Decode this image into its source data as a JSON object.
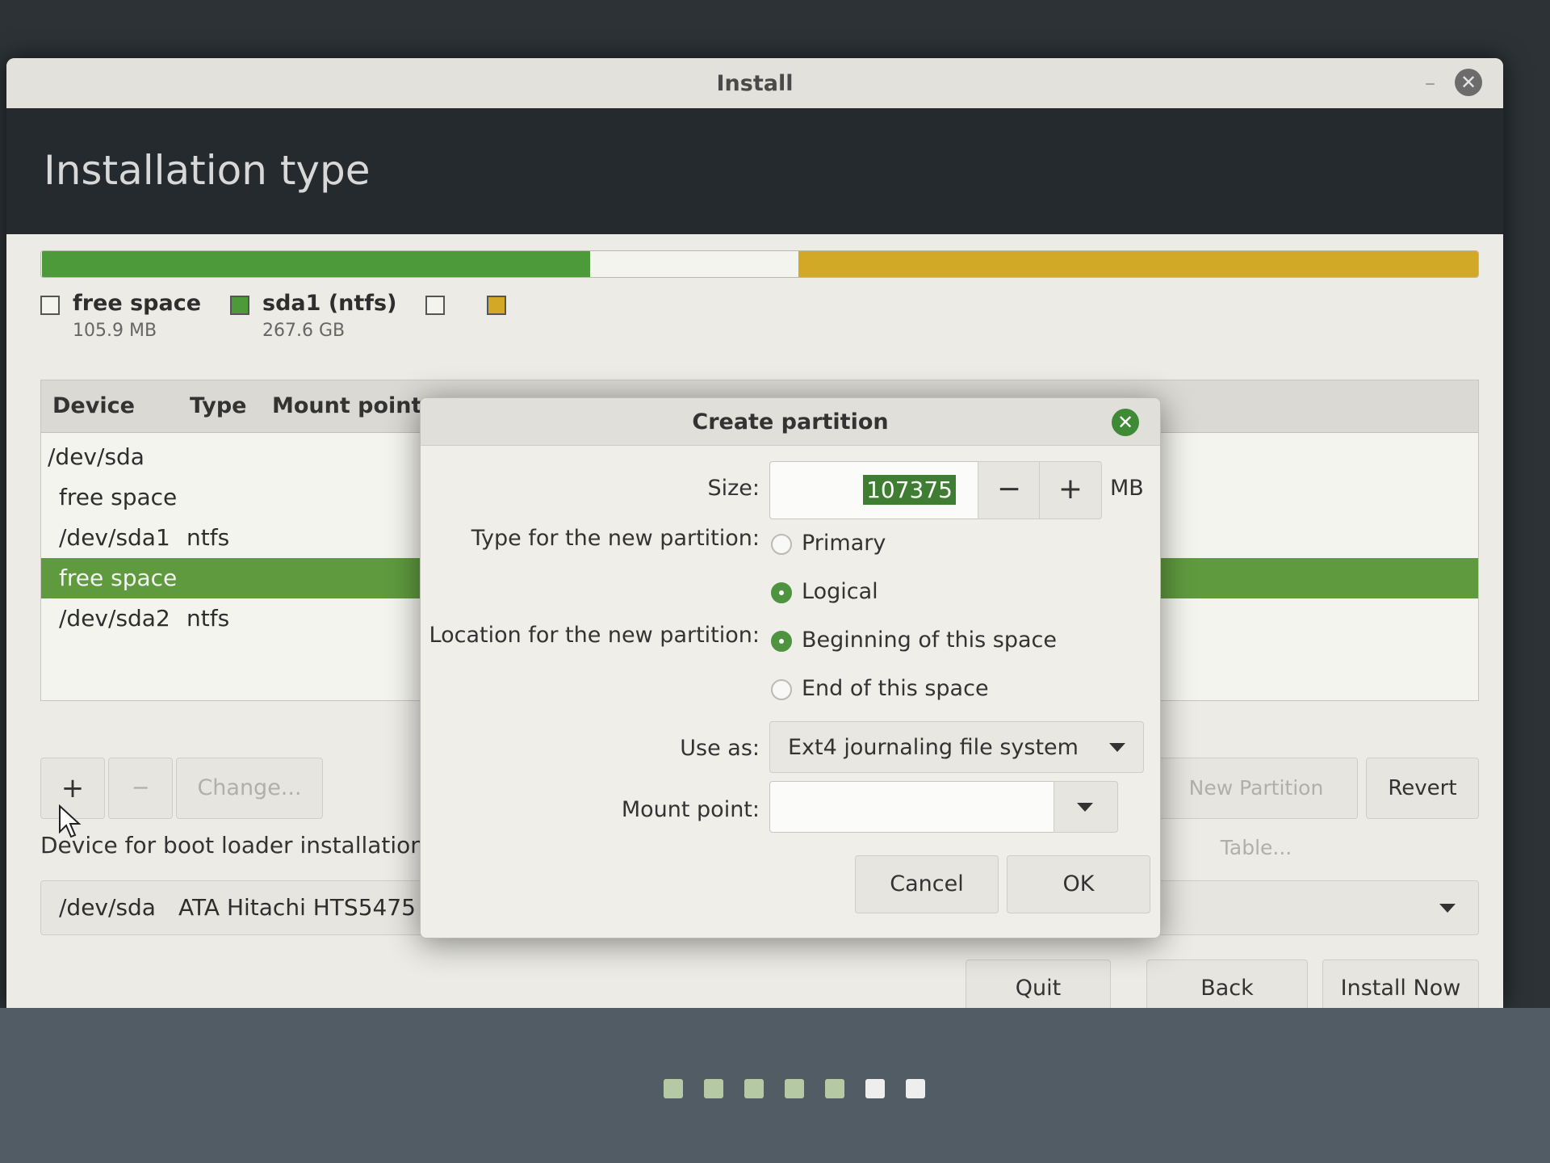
{
  "window": {
    "title": "Install",
    "page_title": "Installation type"
  },
  "partition_bar": {
    "segments": [
      {
        "name": "free space",
        "fraction": 0.0004,
        "color": "#f4f4ef"
      },
      {
        "name": "sda1 (ntfs)",
        "fraction": 0.382,
        "color": "#4c9a3a"
      },
      {
        "name": "free space",
        "fraction": 0.145,
        "color": "#f4f4ef"
      },
      {
        "name": "sda2 (ntfs)",
        "fraction": 0.473,
        "color": "#d2a927"
      }
    ]
  },
  "legend": [
    {
      "name": "free space",
      "size": "105.9 MB",
      "color": "#f4f4ef"
    },
    {
      "name": "sda1 (ntfs)",
      "size": "267.6 GB",
      "color": "#4c9a3a"
    },
    {
      "name": "",
      "size": "",
      "color": "#f4f4ef"
    },
    {
      "name": "",
      "size": "",
      "color": "#d2a927"
    }
  ],
  "table": {
    "headers": {
      "device": "Device",
      "type": "Type",
      "mount": "Mount point"
    },
    "rows": [
      {
        "device": "/dev/sda",
        "type": ""
      },
      {
        "device": "free space",
        "type": ""
      },
      {
        "device": "/dev/sda1",
        "type": "ntfs"
      },
      {
        "device": "free space",
        "type": "",
        "selected": true
      },
      {
        "device": "/dev/sda2",
        "type": "ntfs"
      }
    ]
  },
  "toolbar": {
    "add": "+",
    "remove": "−",
    "change": "Change...",
    "new_table": "New Partition Table...",
    "revert": "Revert"
  },
  "bootloader": {
    "label": "Device for boot loader installation:",
    "device": "/dev/sda",
    "description": "ATA Hitachi HTS5475"
  },
  "nav": {
    "quit": "Quit",
    "back": "Back",
    "install": "Install Now"
  },
  "progress": {
    "total_steps": 7,
    "current_step": 6
  },
  "dialog": {
    "title": "Create partition",
    "size_label": "Size:",
    "size_value": "107375",
    "minus": "−",
    "plus": "+",
    "unit": "MB",
    "type_label": "Type for the new partition:",
    "type_primary": "Primary",
    "type_logical": "Logical",
    "location_label": "Location for the new partition:",
    "location_begin": "Beginning of this space",
    "location_end": "End of this space",
    "useas_label": "Use as:",
    "useas_value": "Ext4 journaling file system",
    "mount_label": "Mount point:",
    "mount_value": "",
    "cancel": "Cancel",
    "ok": "OK"
  }
}
